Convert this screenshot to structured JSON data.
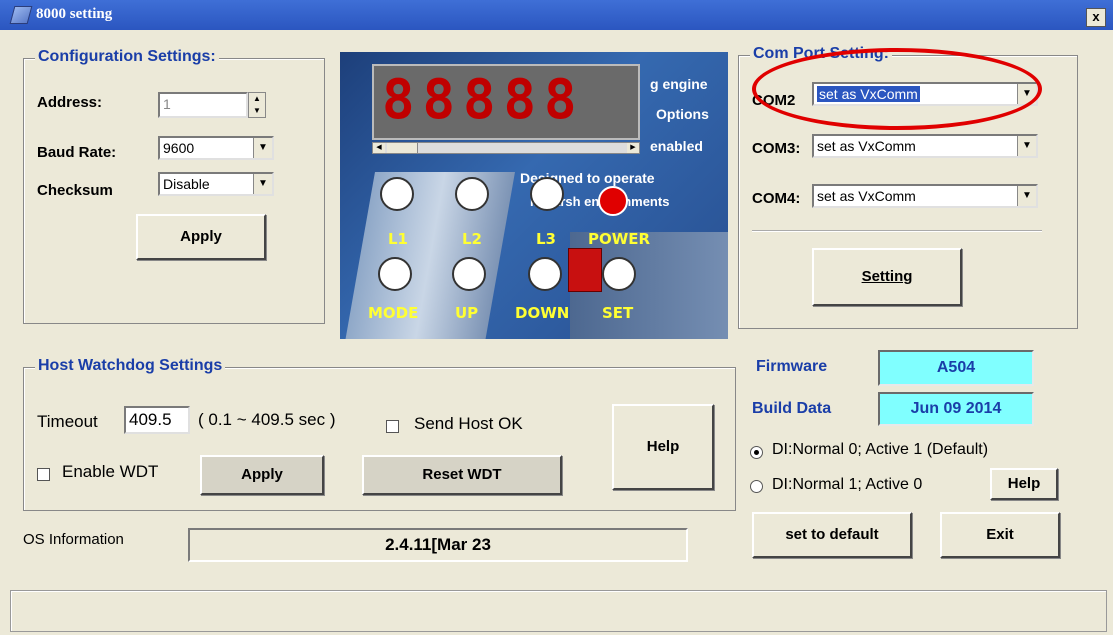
{
  "window": {
    "title": "8000 setting",
    "close_label": "x"
  },
  "config": {
    "legend": "Configuration Settings:",
    "address_label": "Address:",
    "address_value": "1",
    "baud_label": "Baud Rate:",
    "baud_value": "9600",
    "checksum_label": "Checksum",
    "checksum_value": "Disable",
    "apply_label": "Apply"
  },
  "device": {
    "display_digits": "88888",
    "bg_text_1": "g engine",
    "bg_text_2": "Options",
    "bg_text_3": "enabled",
    "bg_text_4": "Designed to operate",
    "bg_text_5": "in harsh environments",
    "leds": [
      "L1",
      "L2",
      "L3",
      "POWER"
    ],
    "buttons": [
      "MODE",
      "UP",
      "DOWN",
      "SET"
    ]
  },
  "com": {
    "legend": "Com Port Setting:",
    "com2_label": "COM2",
    "com2_value": "set as VxComm",
    "com3_label": "COM3:",
    "com3_value": "set as VxComm",
    "com4_label": "COM4:",
    "com4_value": "set as VxComm",
    "setting_label": "Setting"
  },
  "watchdog": {
    "legend": "Host Watchdog Settings",
    "timeout_label": "Timeout",
    "timeout_value": "409.5",
    "range_label": "( 0.1 ~ 409.5 sec )",
    "send_host_ok_label": "Send Host OK",
    "enable_wdt_label": "Enable WDT",
    "apply_label": "Apply",
    "reset_label": "Reset WDT",
    "help_label": "Help"
  },
  "info": {
    "firmware_label": "Firmware",
    "firmware_value": "A504",
    "build_label": "Build Data",
    "build_value": "Jun 09 2014",
    "di_option_1": "DI:Normal 0;  Active 1 (Default)",
    "di_option_2": "DI:Normal 1;  Active 0",
    "di_help_label": "Help",
    "default_label": "set to default",
    "exit_label": "Exit"
  },
  "os": {
    "label": "OS Information",
    "value": "2.4.11[Mar 23"
  },
  "colors": {
    "title_bar": "#2b56c0",
    "legend": "#1a3ea8",
    "info_box": "#80ffff",
    "highlight_ellipse": "#e00000"
  }
}
